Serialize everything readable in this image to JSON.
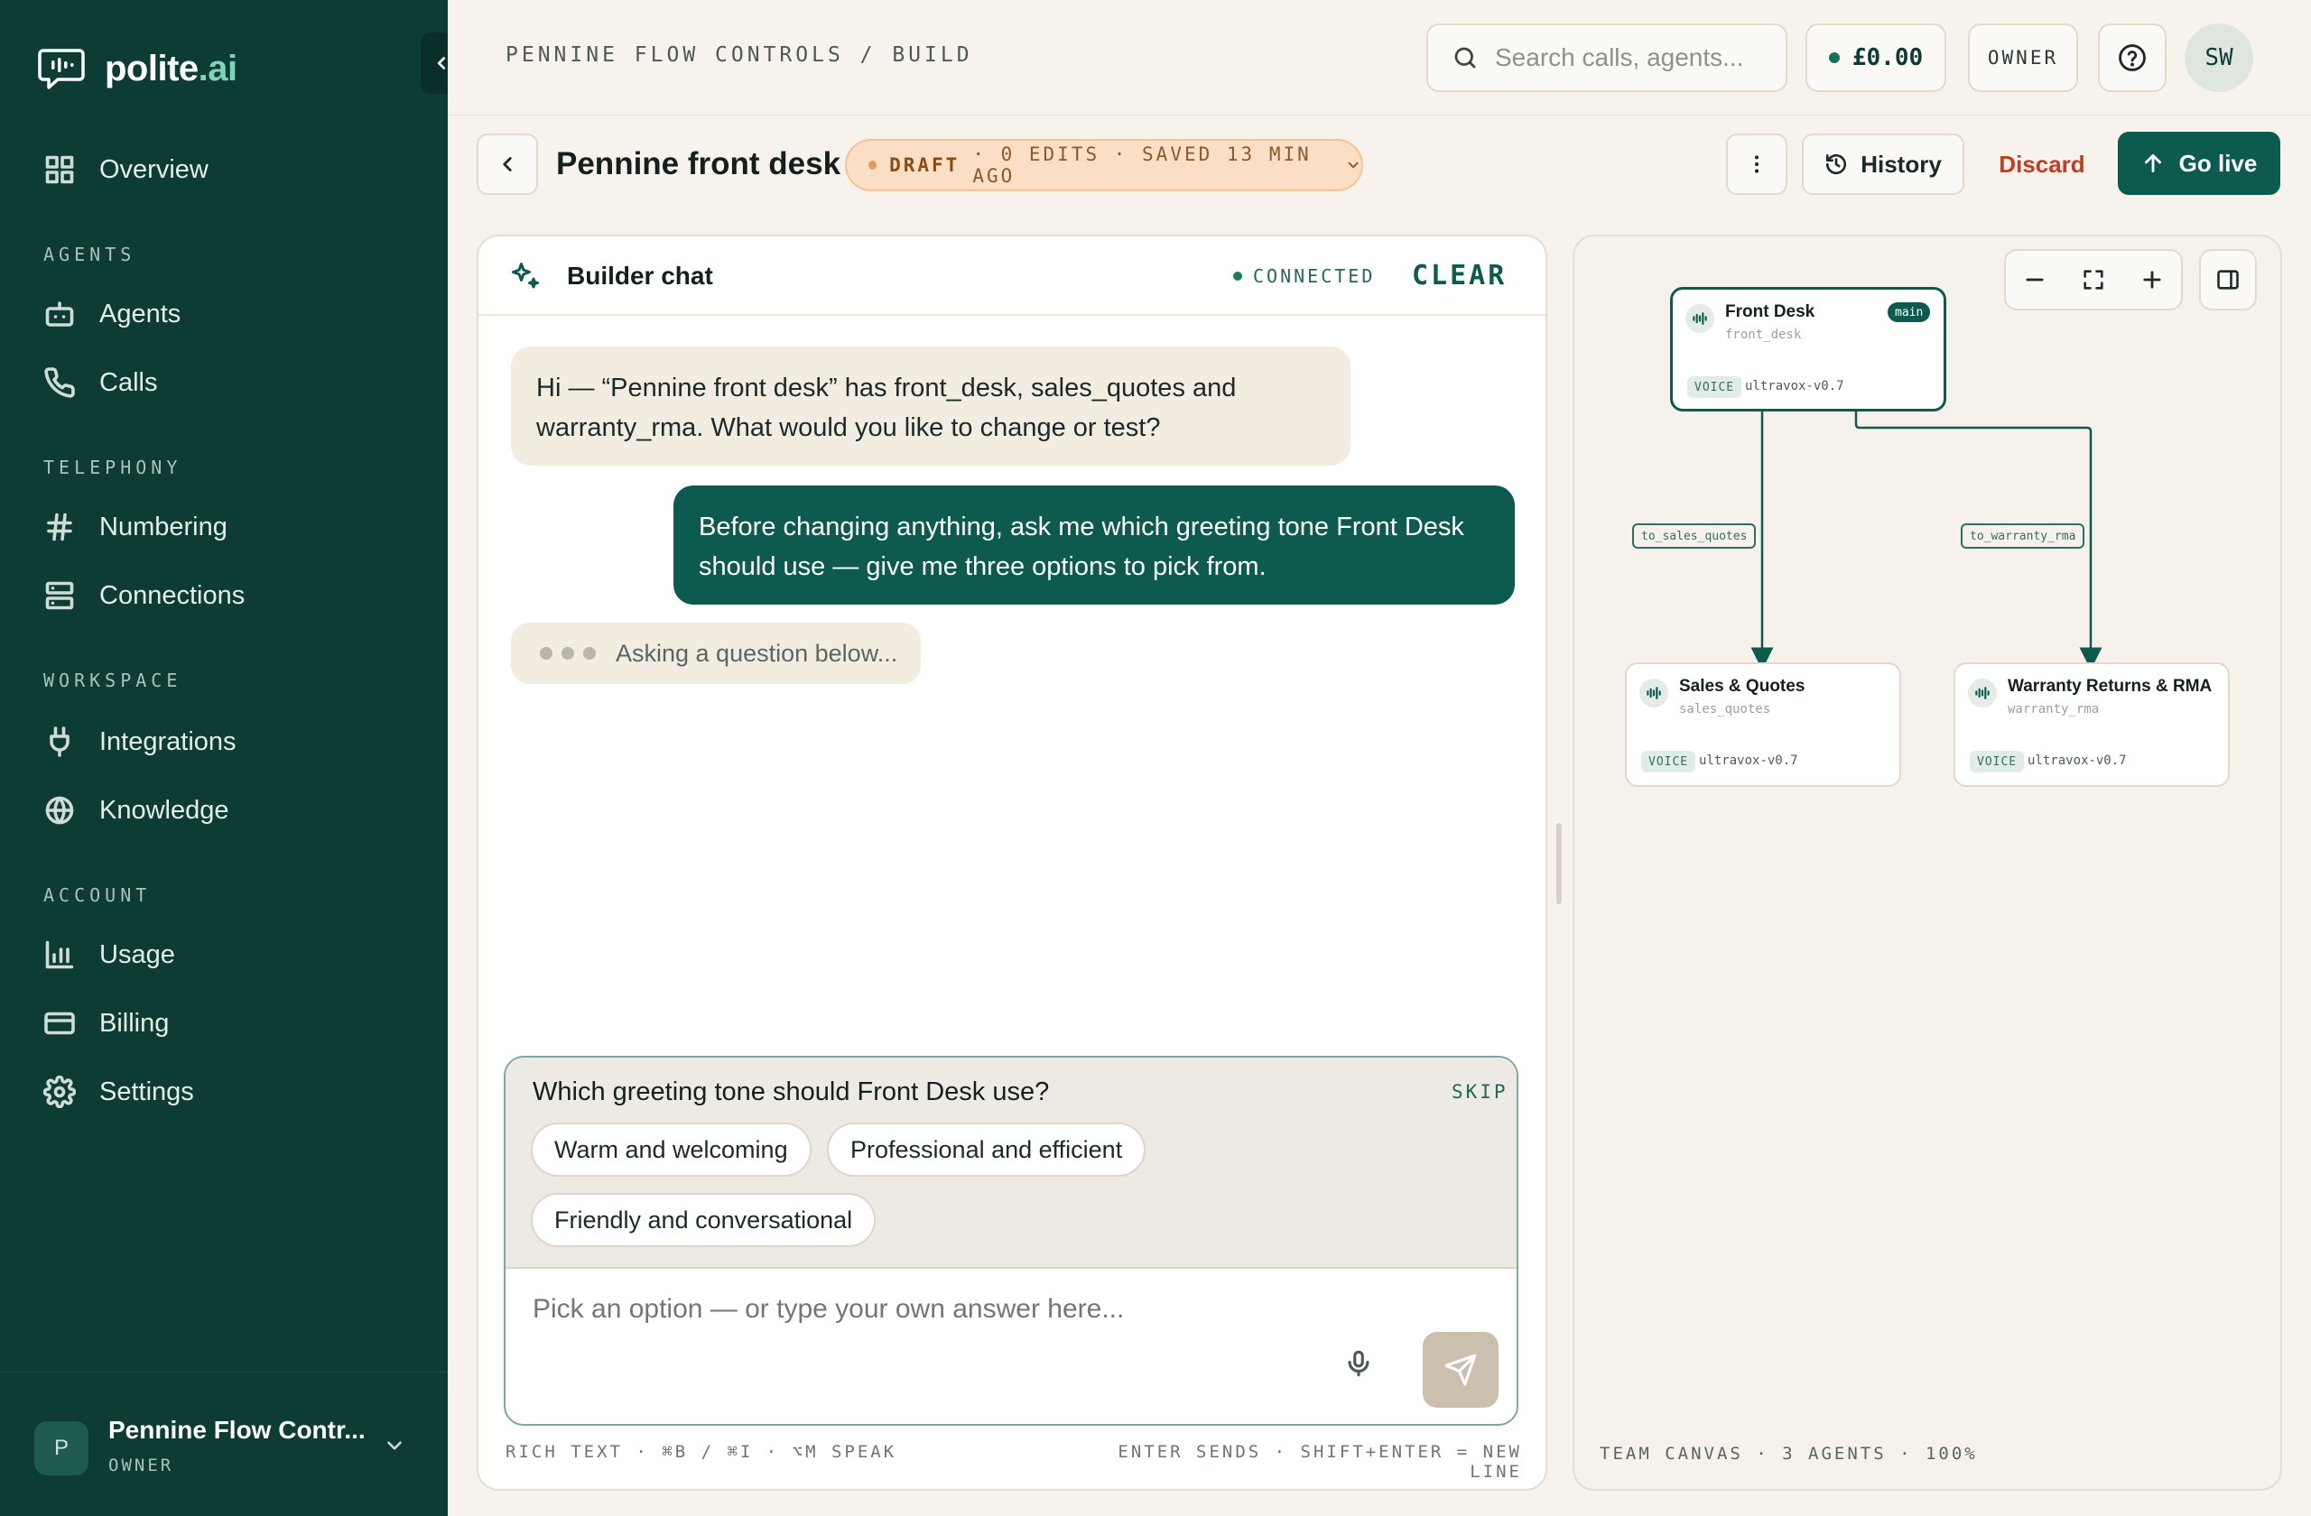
{
  "app": {
    "logo_main": "polite",
    "logo_accent": ".ai"
  },
  "sidebar": {
    "items": {
      "overview": "Overview",
      "agents": "Agents",
      "calls": "Calls",
      "numbering": "Numbering",
      "connections": "Connections",
      "integrations": "Integrations",
      "knowledge": "Knowledge",
      "usage": "Usage",
      "billing": "Billing",
      "settings": "Settings"
    },
    "sections": {
      "agents": "AGENTS",
      "telephony": "TELEPHONY",
      "workspace": "WORKSPACE",
      "account": "ACCOUNT"
    },
    "footer": {
      "avatar": "P",
      "org_name": "Pennine Flow Contr...",
      "role": "OWNER"
    }
  },
  "topbar": {
    "breadcrumb": "PENNINE FLOW CONTROLS / BUILD",
    "search_placeholder": "Search calls, agents...",
    "balance": "£0.00",
    "owner_label": "OWNER",
    "user_initials": "SW"
  },
  "header": {
    "title": "Pennine front desk",
    "draft_label": "DRAFT",
    "draft_meta": "· 0 EDITS · SAVED 13 MIN AGO",
    "history_label": "History",
    "discard_label": "Discard",
    "golive_label": "Go live"
  },
  "chat": {
    "title": "Builder chat",
    "status": "CONNECTED",
    "clear_label": "CLEAR",
    "messages": [
      {
        "role": "assistant",
        "text": "Hi — “Pennine front desk” has front_desk, sales_quotes and warranty_rma. What would you like to change or test?"
      },
      {
        "role": "user",
        "text": "Before changing anything, ask me which greeting tone Front Desk should use — give me three options to pick from."
      }
    ],
    "typing_text": "Asking a question below...",
    "question": {
      "text": "Which greeting tone should Front Desk use?",
      "skip_label": "SKIP",
      "options": [
        "Warm and welcoming",
        "Professional and efficient",
        "Friendly and conversational"
      ]
    },
    "input_placeholder": "Pick an option — or type your own answer here...",
    "footer_left": "RICH TEXT · ⌘B / ⌘I · ⌥M SPEAK",
    "footer_right": "ENTER SENDS · SHIFT+ENTER = NEW LINE"
  },
  "canvas": {
    "nodes": [
      {
        "title": "Front Desk",
        "id": "front_desk",
        "tag": "main",
        "type": "VOICE",
        "model": "ultravox-v0.7"
      },
      {
        "title": "Sales & Quotes",
        "id": "sales_quotes",
        "type": "VOICE",
        "model": "ultravox-v0.7"
      },
      {
        "title": "Warranty Returns & RMA",
        "id": "warranty_rma",
        "type": "VOICE",
        "model": "ultravox-v0.7"
      }
    ],
    "edges": [
      {
        "label": "to_sales_quotes"
      },
      {
        "label": "to_warranty_rma"
      }
    ],
    "footer": "TEAM CANVAS · 3 AGENTS · 100%"
  },
  "colors": {
    "sidebar_bg": "#0d3c35",
    "accent": "#0d5b4e",
    "discard": "#c23b22",
    "draft_bg": "#fbdfc4"
  }
}
